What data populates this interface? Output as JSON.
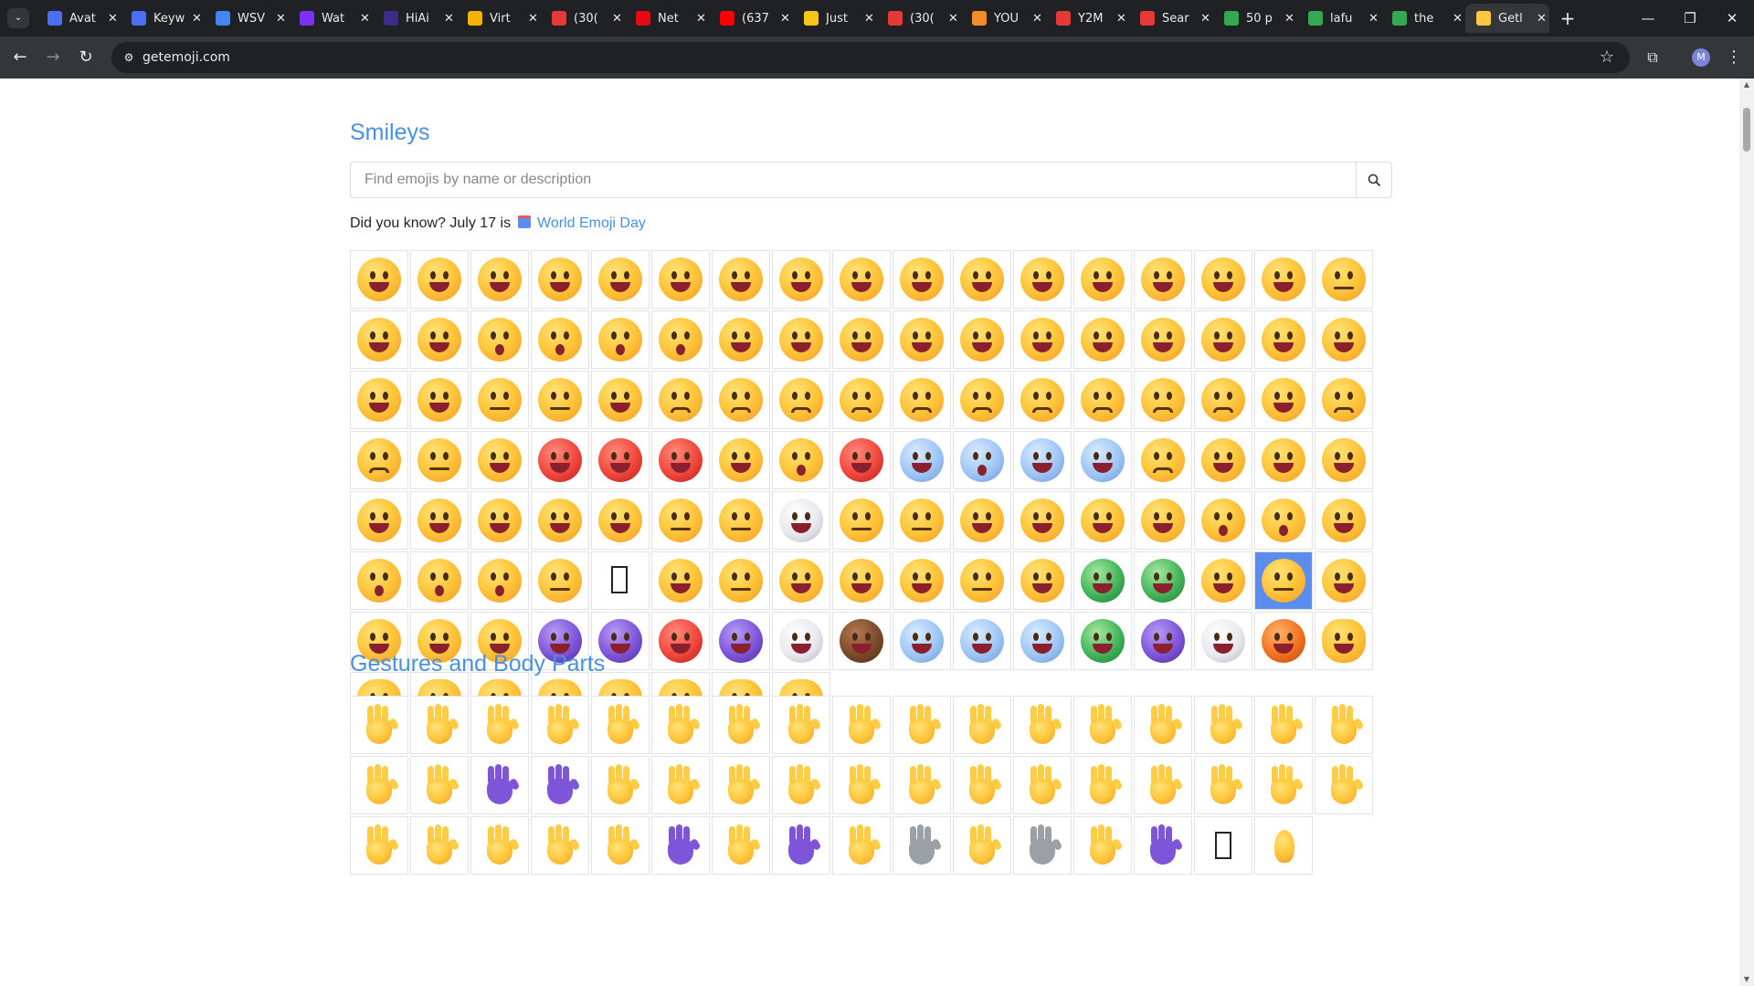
{
  "browser": {
    "tabs": [
      {
        "title": "Avat",
        "favicon_color": "#4c6ef5"
      },
      {
        "title": "Keyw",
        "favicon_color": "#4c6ef5"
      },
      {
        "title": "WSV",
        "favicon_color": "#4285f4"
      },
      {
        "title": "Wat",
        "favicon_color": "#7b2ff7"
      },
      {
        "title": "HiAi",
        "favicon_color": "#3d2a8a"
      },
      {
        "title": "Virt",
        "favicon_color": "#f4b400"
      },
      {
        "title": "(30(",
        "favicon_color": "#e53935"
      },
      {
        "title": "Net",
        "favicon_color": "#e50914"
      },
      {
        "title": "(637",
        "favicon_color": "#ff0000"
      },
      {
        "title": "Just",
        "favicon_color": "#f5c518"
      },
      {
        "title": "(30(",
        "favicon_color": "#e53935"
      },
      {
        "title": "YOU",
        "favicon_color": "#f28c28"
      },
      {
        "title": "Y2M",
        "favicon_color": "#e53935"
      },
      {
        "title": "Sear",
        "favicon_color": "#e53935"
      },
      {
        "title": "50 p",
        "favicon_color": "#34a853"
      },
      {
        "title": "lafu",
        "favicon_color": "#34a853"
      },
      {
        "title": "the",
        "favicon_color": "#34a853"
      },
      {
        "title": "Getl",
        "favicon_color": "#ffc83d"
      }
    ],
    "url": "getemoji.com",
    "profile_initial": "M",
    "new_tab_label": "+",
    "window_controls": {
      "minimize": "—",
      "restore": "❐",
      "close": "✕"
    }
  },
  "page": {
    "sections": [
      {
        "title": "Smileys",
        "search_placeholder": "Find emojis by name or description",
        "did_you_know_prefix": "Did you know? July 17 is",
        "did_you_know_link": "World Emoji Day",
        "emojis": [
          "grinning face",
          "grinning face with big eyes",
          "grinning face with smiling eyes",
          "beaming face with smiling eyes",
          "grinning squinting face",
          "grinning face with sweat",
          "rolling on the floor laughing",
          "face with tears of joy",
          "smiling face with tear",
          "face holding back tears",
          "smiling face",
          "smiling face with smiling eyes",
          "smiling face with halo",
          "slightly smiling face",
          "upside-down face",
          "winking face",
          "relieved face",
          "smiling face with heart-eyes",
          "smiling face with hearts",
          "face blowing a kiss",
          "kissing face",
          "kissing face with smiling eyes",
          "kissing face with closed eyes",
          "face savoring food",
          "face with tongue",
          "squinting face with tongue",
          "winking face with tongue",
          "zany face",
          "face with raised eyebrow",
          "face with monocle",
          "nerd face",
          "smiling face with sunglasses",
          "disguised face",
          "star-struck",
          "partying face",
          "face exhaling",
          "smirking face",
          "unamused face",
          "face with spiral eyes",
          "disappointed face",
          "pensive face",
          "worried face",
          "confused face",
          "slightly frowning face",
          "frowning face",
          "persevering face",
          "confounded face",
          "tired face",
          "weary face",
          "pleading face",
          "crying face",
          "loudly crying face",
          "sleepy face",
          "face with steam from nose",
          "angry face",
          "pouting face",
          "face with symbols on mouth",
          "exploding head",
          "flushed face",
          "hot face",
          "cold face",
          "face screaming in fear",
          "fearful face",
          "anxious face with sweat",
          "sad but relieved face",
          "downcast face with sweat",
          "face with open eyes and hand over mouth",
          "smiling face with open hands",
          "saluting face",
          "face with hand over mouth",
          "thinking face",
          "face with peeking eye",
          "shushing face",
          "face with diagonal mouth",
          "face without mouth",
          "face in clouds",
          "neutral face",
          "expressionless face",
          "grimacing face",
          "face with rolling eyes",
          "melting face",
          "dotted line face",
          "hushed face",
          "astonished face",
          "anguished face",
          "face with open mouth",
          "astonished face alt",
          "yawning face",
          "sleeping face",
          "shaking face",
          "drooling face",
          "sleepy face alt",
          "face with crossed-out eyes",
          "face with spiral eyes alt",
          "dotted line face alt",
          "zipper-mouth face",
          "woozy face",
          "nauseated face",
          "face vomiting",
          "sneezing face",
          "face with medical mask",
          "face with thermometer",
          "face with head-bandage",
          "money-mouth face",
          "cowboy hat face",
          "smiling face with horns",
          "angry face with horns",
          "ogre",
          "goblin",
          "clown face",
          "pile of poo",
          "ghost",
          "skull",
          "skull and crossbones",
          "alien",
          "alien monster",
          "robot",
          "jack-o-lantern",
          "grinning cat",
          "grinning cat with big eyes",
          "cat with tears of joy",
          "smiling cat with heart-eyes",
          "cat with wry smile",
          "kissing cat",
          "weary cat",
          "crying cat",
          "pouting cat"
        ]
      },
      {
        "title": "Gestures and Body Parts",
        "emojis": [
          "waving hand",
          "raised back of hand",
          "hand with fingers splayed",
          "raised hand",
          "vulcan salute",
          "ok hand",
          "pinched fingers",
          "pinching hand",
          "victory hand",
          "crossed fingers",
          "hand with index finger and thumb crossed",
          "love-you gesture",
          "sign of the horns",
          "thumbs up",
          "raised fist",
          "leftwards hand",
          "rightwards hand",
          "palm down hand",
          "palm up hand",
          "leftwards pushing hand",
          "rightwards pushing hand",
          "backhand index pointing left",
          "backhand index pointing right",
          "backhand index pointing up",
          "middle finger",
          "backhand index pointing down",
          "index pointing up",
          "thumbs down",
          "raised fist alt",
          "oncoming fist",
          "left-facing fist",
          "right-facing fist",
          "clapping hands",
          "heart hands",
          "raising hands",
          "open hands",
          "palms up together",
          "handshake",
          "folded hands",
          "writing hand",
          "nail polish",
          "selfie",
          "flexed biceps",
          "mechanical arm",
          "leg",
          "mechanical leg",
          "foot",
          "footprints",
          "unsupported glyph",
          "ear"
        ]
      }
    ]
  },
  "colors": {
    "accent": "#4a90e2",
    "selected": "#5b8def",
    "tab_bar": "#202124",
    "toolbar": "#35363a"
  }
}
